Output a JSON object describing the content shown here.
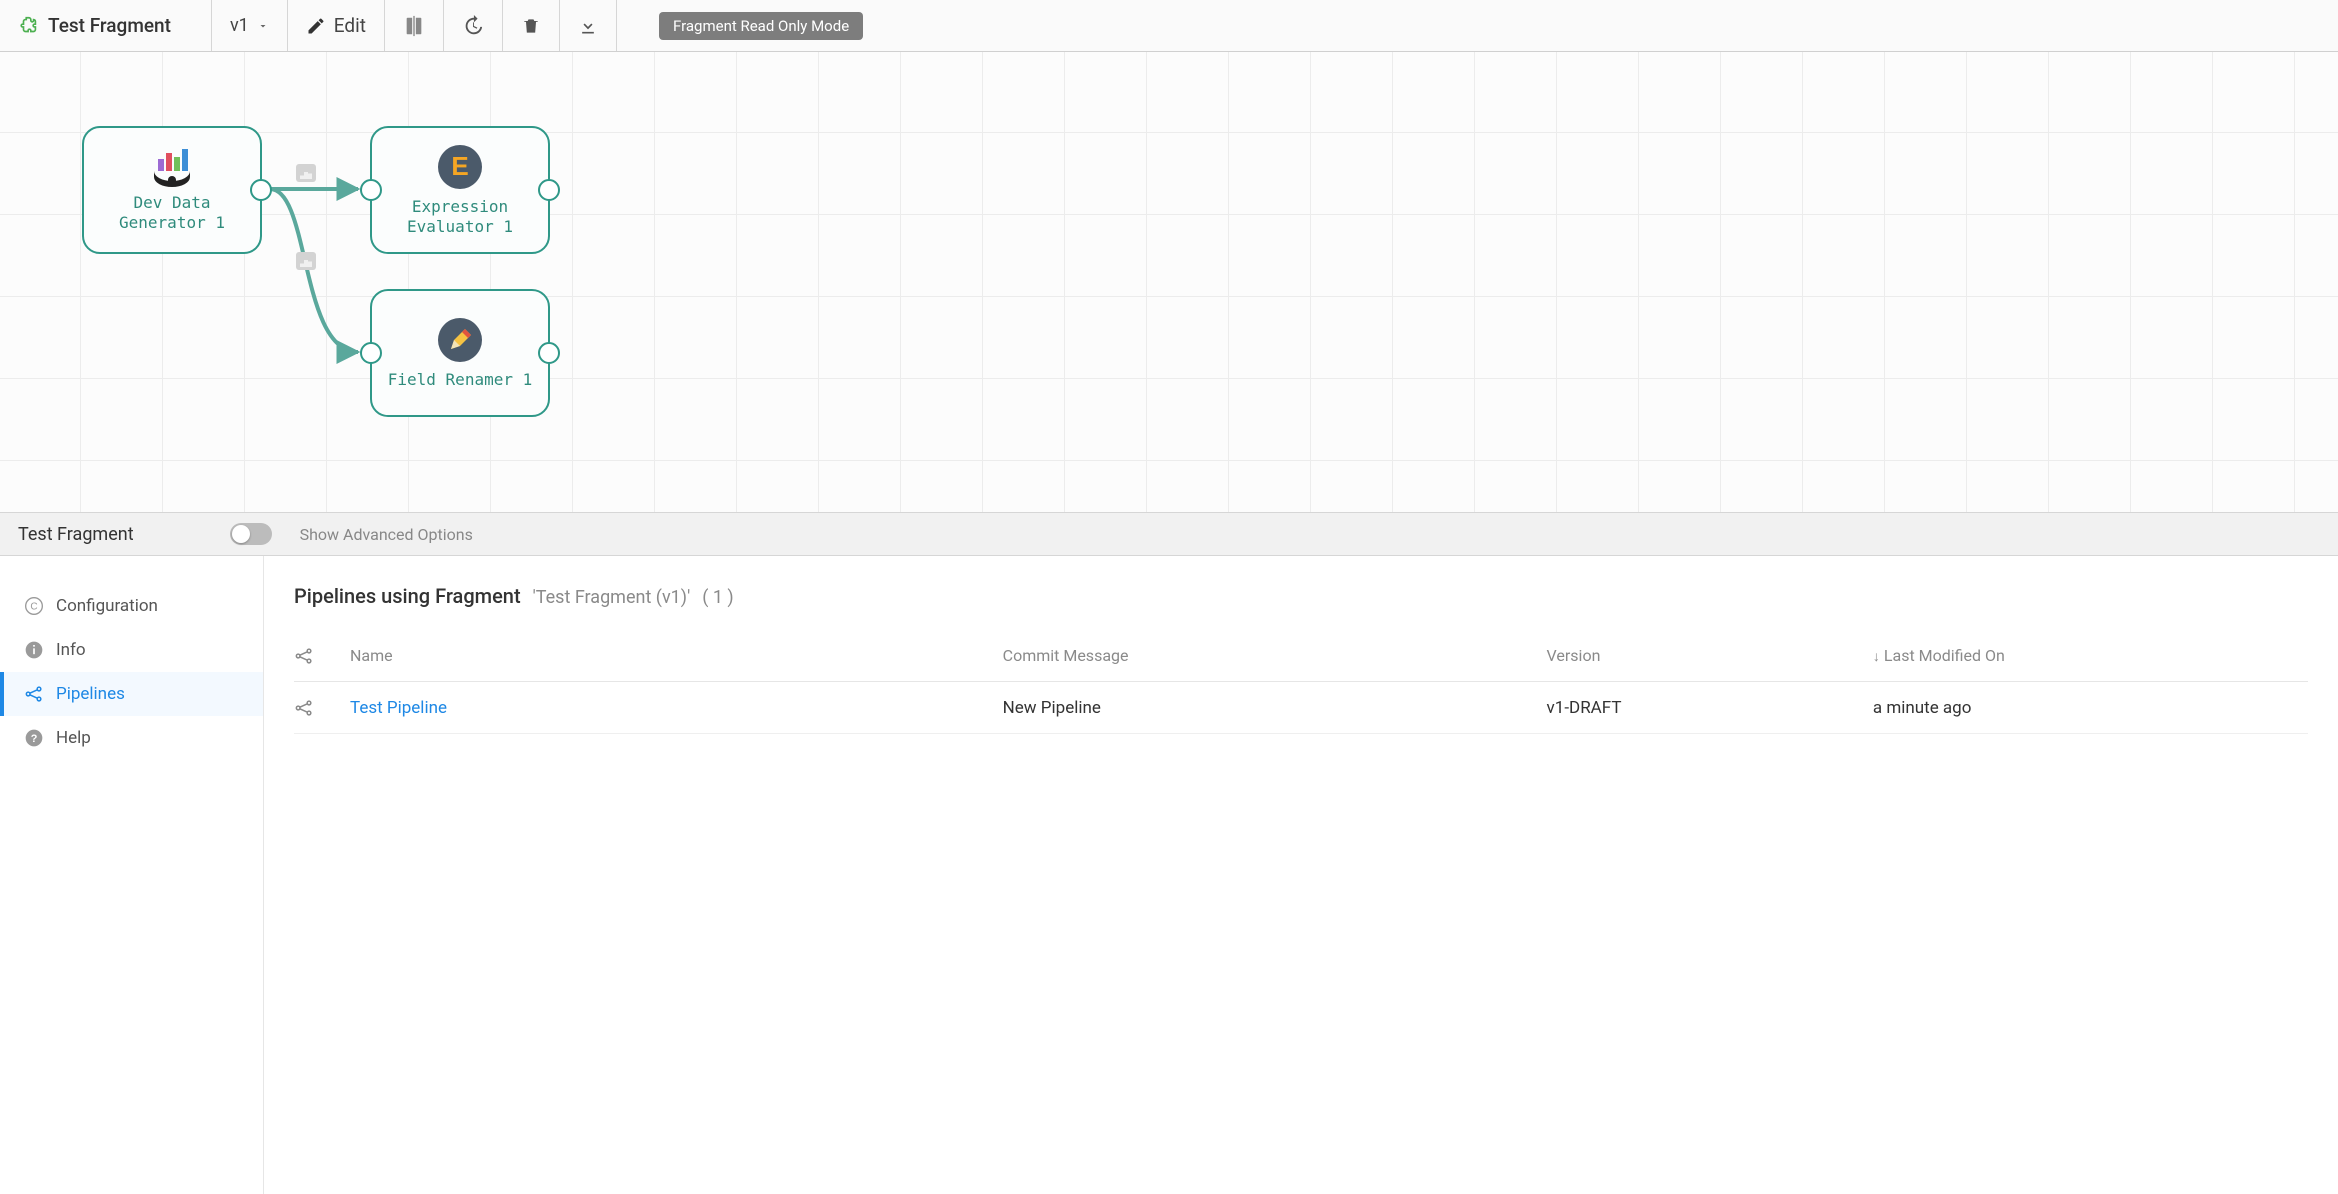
{
  "toolbar": {
    "fragment_title": "Test Fragment",
    "version": "v1",
    "edit_label": "Edit",
    "readonly_badge": "Fragment Read Only Mode"
  },
  "canvas": {
    "nodes": {
      "dev_data_generator": "Dev Data\nGenerator 1",
      "expression_evaluator": "Expression\nEvaluator 1",
      "field_renamer": "Field Renamer 1"
    }
  },
  "config_strip": {
    "title": "Test Fragment",
    "advanced_label": "Show Advanced Options"
  },
  "side_nav": {
    "configuration": "Configuration",
    "info": "Info",
    "pipelines": "Pipelines",
    "help": "Help"
  },
  "panel": {
    "heading": "Pipelines using Fragment",
    "sub_name": "'Test Fragment (v1)'",
    "sub_count": "( 1 )",
    "columns": {
      "name": "Name",
      "commit": "Commit Message",
      "version": "Version",
      "modified": "Last Modified On"
    },
    "rows": [
      {
        "name": "Test Pipeline",
        "commit": "New Pipeline",
        "version": "v1-DRAFT",
        "modified": "a minute ago"
      }
    ]
  }
}
